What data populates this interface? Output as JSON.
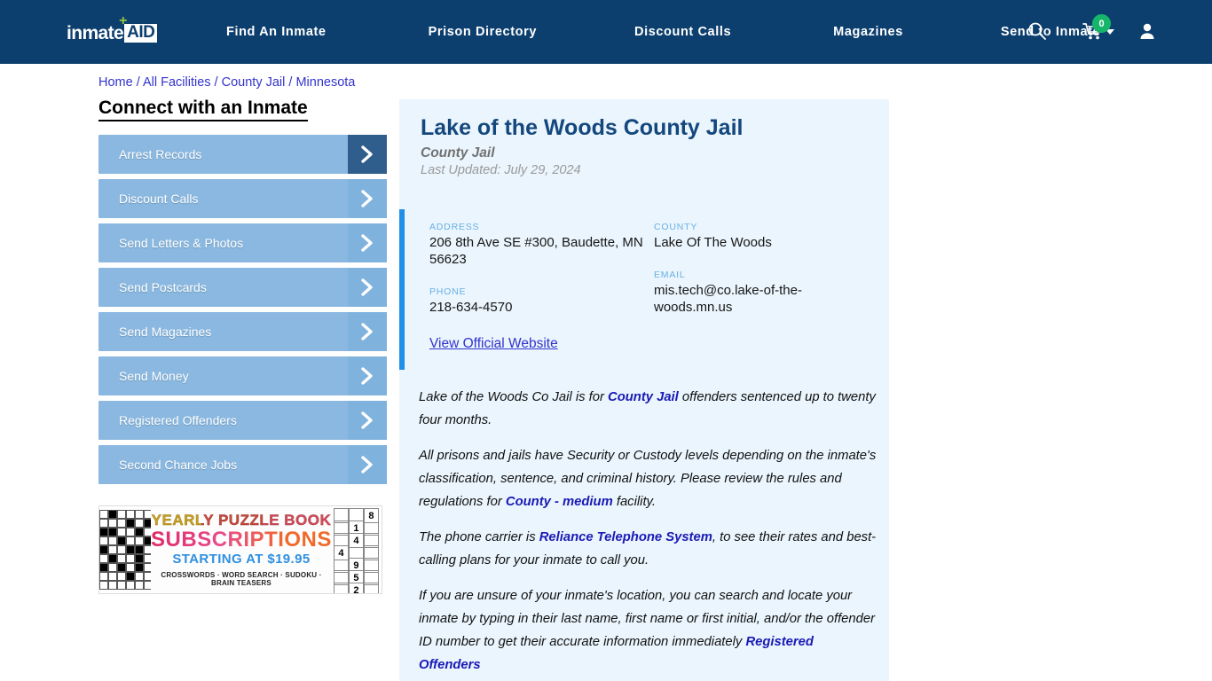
{
  "header": {
    "logo": {
      "word": "inmate",
      "badge": "AID",
      "plus": "+"
    },
    "nav": [
      {
        "label": "Find An Inmate"
      },
      {
        "label": "Prison Directory"
      },
      {
        "label": "Discount Calls"
      },
      {
        "label": "Magazines"
      },
      {
        "label": "Send to Inmate",
        "has_caret": true
      }
    ],
    "icons": {
      "search": "search-icon",
      "cart": "shopping-cart-icon",
      "cart_count": "0",
      "account": "user-account-icon"
    },
    "colors": {
      "bar": "#0d3f6e",
      "badge": "#15b56a"
    }
  },
  "breadcrumb": {
    "items": [
      "Home",
      "All Facilities",
      "County Jail",
      "Minnesota"
    ],
    "separator": "/"
  },
  "sidebar": {
    "title": "Connect with an Inmate",
    "items": [
      {
        "label": "Arrest Records",
        "active": true
      },
      {
        "label": "Discount Calls",
        "active": false
      },
      {
        "label": "Send Letters & Photos",
        "active": false
      },
      {
        "label": "Send Postcards",
        "active": false
      },
      {
        "label": "Send Magazines",
        "active": false
      },
      {
        "label": "Send Money",
        "active": false
      },
      {
        "label": "Registered Offenders",
        "active": false
      },
      {
        "label": "Second Chance Jobs",
        "active": false
      }
    ]
  },
  "ad": {
    "line1": "YEARLY PUZZLE BOOK",
    "line2": "SUBSCRIPTIONS",
    "line3": "STARTING AT $19.95",
    "line4": "CROSSWORDS · WORD SEARCH · SUDOKU · BRAIN TEASERS",
    "sudoku_digits": [
      "8",
      "1",
      "4",
      "4",
      "9",
      "5",
      "2"
    ]
  },
  "facility": {
    "name": "Lake of the Woods County Jail",
    "type": "County Jail",
    "last_updated": "Last Updated: July 29, 2024",
    "info": {
      "address_label": "ADDRESS",
      "address_value": "206 8th Ave SE #300, Baudette, MN 56623",
      "county_label": "COUNTY",
      "county_value": "Lake Of The Woods",
      "phone_label": "PHONE",
      "phone_value": "218-634-4570",
      "email_label": "EMAIL",
      "email_value": "mis.tech@co.lake-of-the-woods.mn.us"
    },
    "official_website_link": "View Official Website"
  },
  "description": {
    "p1_a": "Lake of the Woods Co Jail is for ",
    "p1_b": "County Jail",
    "p1_c": " offenders sentenced up to twenty four months.",
    "p2_a": "All prisons and jails have Security or Custody levels depending on the inmate's classification, sentence, and criminal history. Please review the rules and regulations for ",
    "p2_b": "County - medium",
    "p2_c": " facility.",
    "p3_a": "The phone carrier is ",
    "p3_b": "Reliance Telephone System",
    "p3_c": ", to see their rates and best-calling plans for your inmate to call you.",
    "p4_a": "If you are unsure of your inmate's location, you can search and locate your inmate by typing in their last name, first name or first initial, and/or the offender ID number to get their accurate information immediately ",
    "p4_b": "Registered Offenders"
  }
}
